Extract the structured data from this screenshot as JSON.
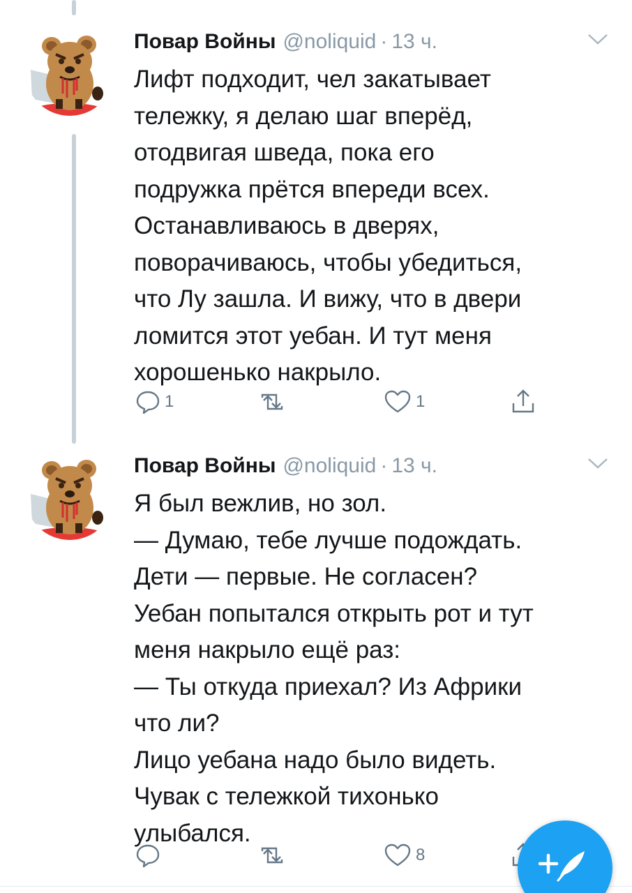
{
  "colors": {
    "accent": "#1da1f2",
    "muted_text": "#8899a6",
    "action_icon": "#657786",
    "thread_line": "#c8d1d8"
  },
  "tweets": [
    {
      "author_name": "Повар Войны",
      "handle": "@noliquid",
      "separator": "·",
      "time": "13 ч.",
      "avatar_icon": "angry-bear-avatar-icon",
      "text_lines": [
        "Лифт подходит, чел закатывает",
        "тележку, я делаю шаг вперёд,",
        "отодвигая шведа, пока его",
        "подружка прётся впереди всех.",
        "Останавливаюсь в дверях,",
        "поворачиваюсь, чтобы убедиться,",
        "что Лу зашла. И вижу, что в двери",
        "ломится этот уебан. И тут меня",
        "хорошенько накрыло."
      ],
      "reply_count": "1",
      "retweet_count": "",
      "like_count": "1"
    },
    {
      "author_name": "Повар Войны",
      "handle": "@noliquid",
      "separator": "·",
      "time": "13 ч.",
      "avatar_icon": "angry-bear-avatar-icon",
      "text_lines": [
        "Я был вежлив, но зол.",
        "— Думаю, тебе лучше подождать.",
        "Дети — первые. Не согласен?",
        "Уебан попытался открыть рот и тут",
        "меня накрыло ещё раз:",
        "— Ты откуда приехал? Из Африки",
        "что ли?",
        "Лицо уебана надо было видеть.",
        "Чувак с тележкой тихонько",
        "улыбался."
      ],
      "reply_count": "",
      "retweet_count": "",
      "like_count": "8"
    }
  ],
  "fab": {
    "icon": "compose-tweet-icon"
  }
}
